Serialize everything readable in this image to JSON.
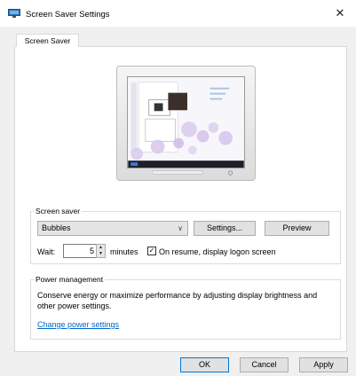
{
  "window": {
    "title": "Screen Saver Settings",
    "close_glyph": "✕",
    "icon": "screen-saver-monitor-icon"
  },
  "tabs": [
    {
      "label": "Screen Saver",
      "selected": true
    }
  ],
  "screen_saver": {
    "group_label": "Screen saver",
    "selected": "Bubbles",
    "settings_label": "Settings...",
    "preview_label": "Preview",
    "wait_label": "Wait:",
    "wait_value": "5",
    "minutes_label": "minutes",
    "resume_checked": true,
    "resume_label": "On resume, display logon screen"
  },
  "power": {
    "group_label": "Power management",
    "description": "Conserve energy or maximize performance by adjusting display brightness and other power settings.",
    "link_label": "Change power settings"
  },
  "footer": {
    "ok_label": "OK",
    "cancel_label": "Cancel",
    "apply_label": "Apply"
  },
  "colors": {
    "link": "#0066cc",
    "default_button_border": "#0078d7",
    "dialog_background": "#f0f0f0"
  }
}
